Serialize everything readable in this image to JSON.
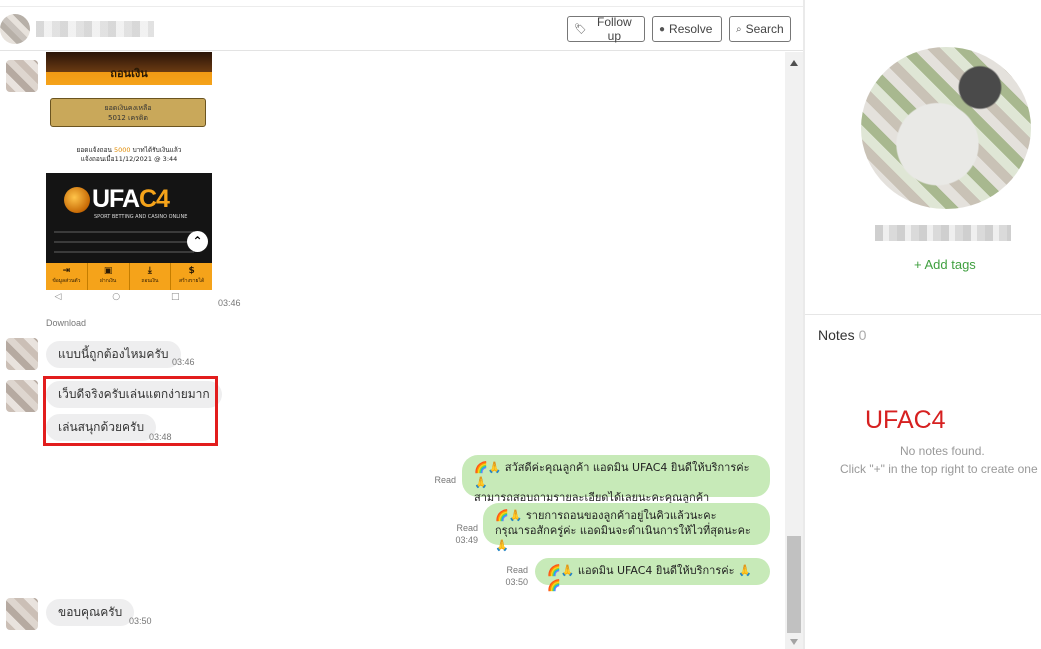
{
  "header": {
    "follow_up": "Follow up",
    "resolve": "Resolve",
    "search": "Search"
  },
  "image_message": {
    "top_label": "ถอนเงิน",
    "balance_line1": "ยอดเงินคงเหลือ",
    "balance_line2": "5012 เครดิต",
    "withdraw_text_a": "ยอดแจ้งถอน",
    "withdraw_amount": "5000",
    "withdraw_text_b": "บาทได้รับเงินแล้ว",
    "withdraw_date": "แจ้งถอนเมื่อ11/12/2021 @ 3:44",
    "brand_main": "UFA",
    "brand_accent": "C4",
    "brand_sub": "SPORT BETTING AND CASINO ONLINE",
    "nav": [
      {
        "icon": "⇥",
        "label": "ข้อมูลส่วนตัว"
      },
      {
        "icon": "▣",
        "label": "ฝากเงิน"
      },
      {
        "icon": "⤓",
        "label": "ถอนเงิน"
      },
      {
        "icon": "$",
        "label": "สร้างรายได้"
      }
    ],
    "sysbar": "◁ ○ □",
    "time": "03:46",
    "download": "Download"
  },
  "messages_in": [
    {
      "text": "แบบนี้ถูกต้องไหมครับ",
      "time": "03:46"
    },
    {
      "text": "เว็บดีจริงครับเล่นแตกง่ายมาก",
      "time": ""
    },
    {
      "text": "เล่นสนุกด้วยครับ",
      "time": "03:48"
    },
    {
      "text": "ขอบคุณครับ",
      "time": "03:50"
    }
  ],
  "messages_out": [
    {
      "status": "Read",
      "time": "",
      "line1": "🌈🙏 สวัสดีค่ะคุณลูกค้า แอดมิน UFAC4 ยินดีให้บริการค่ะ 🙏",
      "line2": "สามารถสอบถามรายละเอียดได้เลยนะคะคุณลูกค้า"
    },
    {
      "status": "Read",
      "time": "03:49",
      "line1": "🌈🙏 รายการถอนของลูกค้าอยู่ในคิวแล้วนะคะ",
      "line2": "กรุณารอสักครู่ค่ะ แอดมินจะดำเนินการให้ไวที่สุดนะคะ 🙏"
    },
    {
      "status": "Read",
      "time": "03:50",
      "line1": "🌈🙏 แอดมิน UFAC4 ยินดีให้บริการค่ะ 🙏🌈",
      "line2": ""
    }
  ],
  "panel": {
    "add_tags": "+ Add tags",
    "notes_title": "Notes",
    "notes_count": "0",
    "overlay_label": "UFAC4",
    "no_notes": "No notes found.",
    "no_notes_hint": "Click \"+\" in the top right to create one"
  },
  "colors": {
    "outgoing_bubble": "#c7eab8",
    "incoming_bubble": "#eeeeef",
    "highlight": "#e21d1d",
    "add_tags": "#3f9f3f"
  }
}
